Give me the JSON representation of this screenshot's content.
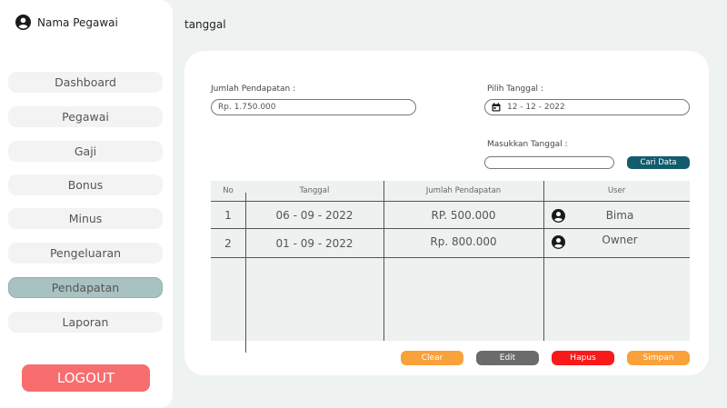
{
  "sidebar": {
    "user_name": "Nama Pegawai",
    "items": [
      {
        "label": "Dashboard"
      },
      {
        "label": "Pegawai"
      },
      {
        "label": "Gaji"
      },
      {
        "label": "Bonus"
      },
      {
        "label": "Minus"
      },
      {
        "label": "Pengeluaran"
      },
      {
        "label": "Pendapatan"
      },
      {
        "label": "Laporan"
      }
    ],
    "active_item": "Pendapatan",
    "logout_label": "LOGOUT"
  },
  "header": {
    "title": "tanggal"
  },
  "form": {
    "income_label": "Jumlah Pendapatan :",
    "income_value": "Rp. 1.750.000",
    "date_label": "Pilih Tanggal :",
    "date_value": "12 - 12 - 2022",
    "search_label": "Masukkan Tanggal :",
    "search_value": "",
    "search_button": "Cari Data"
  },
  "table": {
    "columns": [
      "No",
      "Tanggal",
      "Jumlah Pendapatan",
      "User"
    ],
    "rows": [
      {
        "no": "1",
        "tanggal": "06 - 09 - 2022",
        "jumlah": "RP. 500.000",
        "user": "Bima"
      },
      {
        "no": "2",
        "tanggal": "01 - 09 - 2022",
        "jumlah": "Rp. 800.000",
        "user": "Owner"
      }
    ]
  },
  "actions": {
    "clear": "Clear",
    "edit": "Edit",
    "hapus": "Hapus",
    "simpan": "Simpan"
  },
  "colors": {
    "accent": "#135c6e",
    "active_nav": "#a8c2c1",
    "logout": "#f86d6d",
    "clear": "#f9a13a",
    "edit": "#6b6b6b",
    "hapus": "#f81a1a",
    "simpan": "#f9a13a"
  }
}
